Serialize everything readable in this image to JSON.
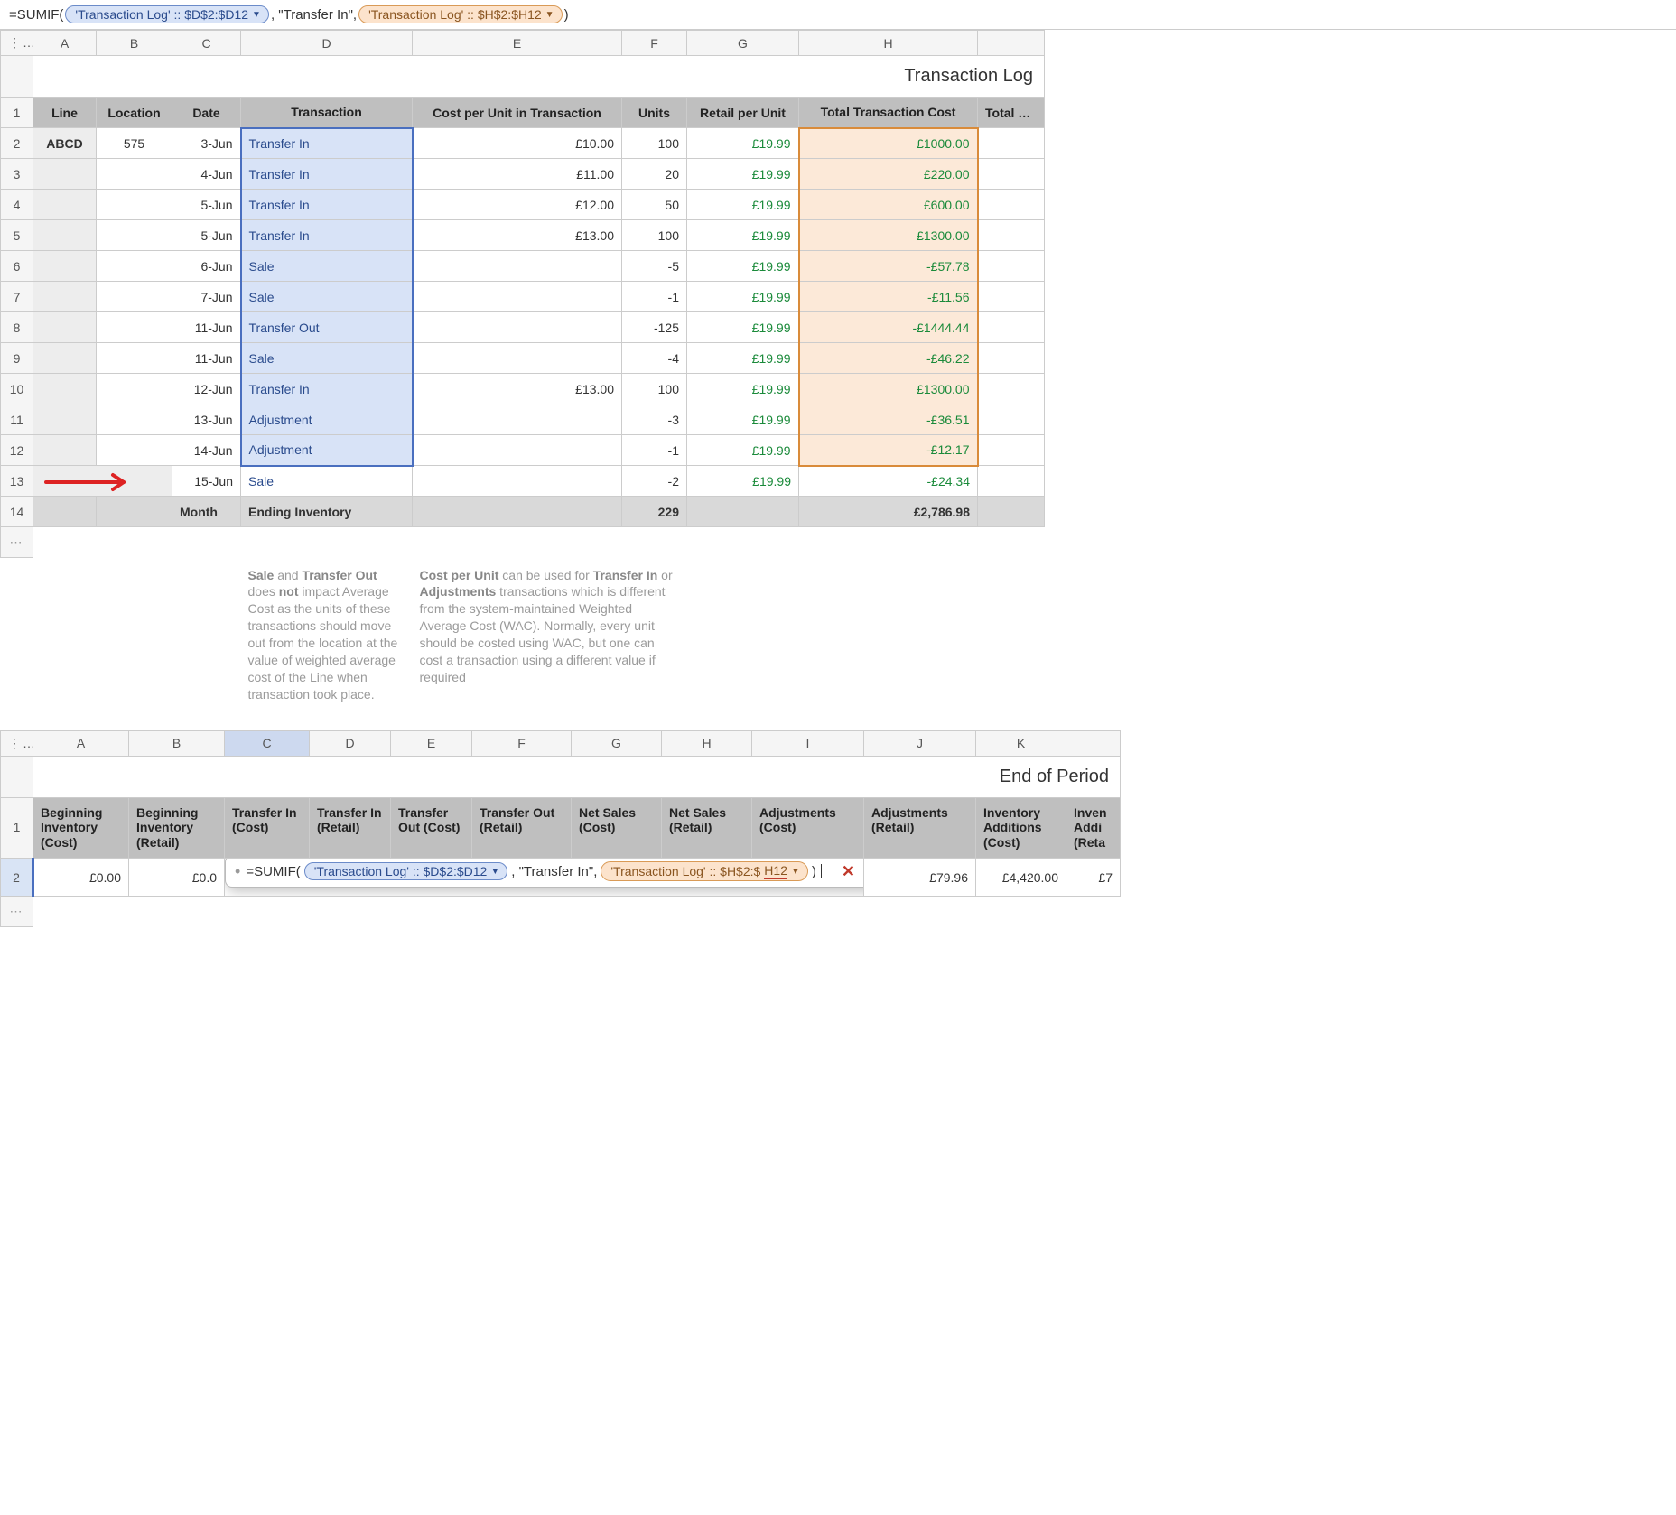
{
  "formulaBarTop": {
    "prefix": "=SUMIF(",
    "token1": "'Transaction Log' :: $D$2:$D12",
    "mid": " , \"Transfer In\", ",
    "token2": "'Transaction Log' :: $H$2:$H12",
    "suffix": ")"
  },
  "topTable": {
    "title": "Transaction Log",
    "cols": [
      "A",
      "B",
      "C",
      "D",
      "E",
      "F",
      "G",
      "H"
    ],
    "partialCol": "Total Tra",
    "headers": {
      "A": "Line",
      "B": "Location",
      "C": "Date",
      "D": "Transaction",
      "E": "Cost per Unit in Transaction",
      "F": "Units",
      "G": "Retail per Unit",
      "H": "Total Transaction Cost"
    },
    "rows": [
      {
        "n": "2",
        "A": "ABCD",
        "B": "575",
        "C": "3-Jun",
        "D": "Transfer In",
        "E": "£10.00",
        "F": "100",
        "G": "£19.99",
        "H": "£1000.00"
      },
      {
        "n": "3",
        "A": "",
        "B": "",
        "C": "4-Jun",
        "D": "Transfer In",
        "E": "£11.00",
        "F": "20",
        "G": "£19.99",
        "H": "£220.00"
      },
      {
        "n": "4",
        "A": "",
        "B": "",
        "C": "5-Jun",
        "D": "Transfer In",
        "E": "£12.00",
        "F": "50",
        "G": "£19.99",
        "H": "£600.00"
      },
      {
        "n": "5",
        "A": "",
        "B": "",
        "C": "5-Jun",
        "D": "Transfer In",
        "E": "£13.00",
        "F": "100",
        "G": "£19.99",
        "H": "£1300.00"
      },
      {
        "n": "6",
        "A": "",
        "B": "",
        "C": "6-Jun",
        "D": "Sale",
        "E": "",
        "F": "-5",
        "G": "£19.99",
        "H": "-£57.78"
      },
      {
        "n": "7",
        "A": "",
        "B": "",
        "C": "7-Jun",
        "D": "Sale",
        "E": "",
        "F": "-1",
        "G": "£19.99",
        "H": "-£11.56"
      },
      {
        "n": "8",
        "A": "",
        "B": "",
        "C": "11-Jun",
        "D": "Transfer Out",
        "E": "",
        "F": "-125",
        "G": "£19.99",
        "H": "-£1444.44"
      },
      {
        "n": "9",
        "A": "",
        "B": "",
        "C": "11-Jun",
        "D": "Sale",
        "E": "",
        "F": "-4",
        "G": "£19.99",
        "H": "-£46.22"
      },
      {
        "n": "10",
        "A": "",
        "B": "",
        "C": "12-Jun",
        "D": "Transfer In",
        "E": "£13.00",
        "F": "100",
        "G": "£19.99",
        "H": "£1300.00"
      },
      {
        "n": "11",
        "A": "",
        "B": "",
        "C": "13-Jun",
        "D": "Adjustment",
        "E": "",
        "F": "-3",
        "G": "£19.99",
        "H": "-£36.51"
      },
      {
        "n": "12",
        "A": "",
        "B": "",
        "C": "14-Jun",
        "D": "Adjustment",
        "E": "",
        "F": "-1",
        "G": "£19.99",
        "H": "-£12.17"
      },
      {
        "n": "13",
        "A": "",
        "B": "",
        "C": "15-Jun",
        "D": "Sale",
        "E": "",
        "F": "-2",
        "G": "£19.99",
        "H": "-£24.34"
      }
    ],
    "summary": {
      "n": "14",
      "C": "Month",
      "D": "Ending Inventory",
      "F": "229",
      "H": "£2,786.98"
    }
  },
  "notes": {
    "left": "Sale and Transfer Out does not impact Average Cost as the units of these transactions should move out from the location at the value of weighted average cost of the Line when transaction took place.",
    "leftBold1": "Sale",
    "leftBold2": "Transfer Out",
    "leftBold3": "not",
    "right": "Cost per Unit can be used for Transfer In or Adjustments transactions which is different from the system-maintained Weighted Average Cost (WAC). Normally, every unit should be costed using WAC, but one can cost a transaction using a different value if required",
    "rightBold1": "Cost per Unit",
    "rightBold2": "Transfer In",
    "rightBold3": "Adjustments"
  },
  "bottomTable": {
    "title": "End of Period",
    "cols": [
      "A",
      "B",
      "C",
      "D",
      "E",
      "F",
      "G",
      "H",
      "I",
      "J",
      "K"
    ],
    "partialCol": "Inven",
    "headers": {
      "A": "Beginning Inventory (Cost)",
      "B": "Beginning Inventory (Retail)",
      "C": "Transfer In (Cost)",
      "D": "Transfer In (Retail)",
      "E": "Transfer Out (Cost)",
      "F": "Transfer Out (Retail)",
      "G": "Net Sales (Cost)",
      "H": "Net Sales (Retail)",
      "I": "Adjustments (Cost)",
      "J": "Adjustments (Retail)",
      "K": "Inventory Additions (Cost)"
    },
    "partialHeader": "Inven Addi (Reta",
    "row2": {
      "A": "£0.00",
      "B": "£0.0",
      "J": "£79.96",
      "K": "£4,420.00",
      "partial": "£7"
    }
  },
  "inlineFormula": {
    "prefix": "=SUMIF(",
    "token1": "'Transaction Log' :: $D$2:$D12",
    "mid": " , \"Transfer In\", ",
    "token2pre": "'Transaction Log' :: $H$2:$",
    "token2under": "H12",
    "suffix": ")"
  }
}
